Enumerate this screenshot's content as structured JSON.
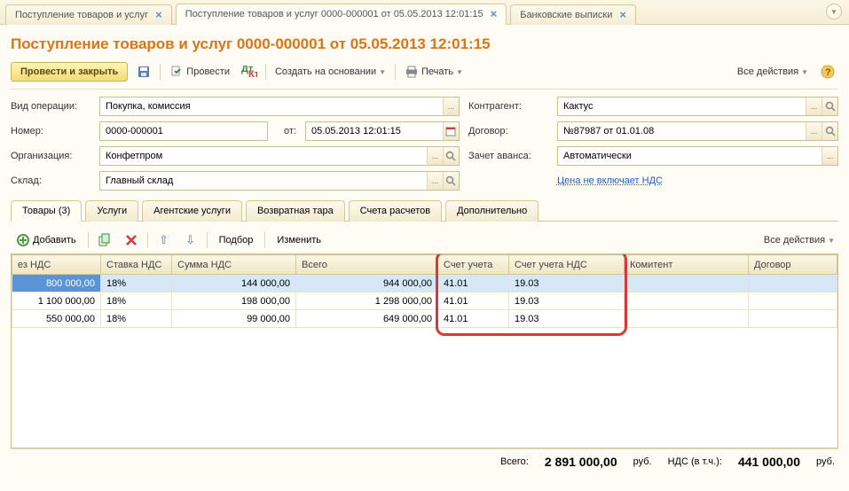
{
  "tabs": [
    {
      "label": "Поступление товаров и услуг"
    },
    {
      "label": "Поступление товаров и услуг 0000-000001 от 05.05.2013 12:01:15"
    },
    {
      "label": "Банковские выписки"
    }
  ],
  "title": "Поступление товаров и услуг 0000-000001 от 05.05.2013 12:01:15",
  "toolbar": {
    "post_close": "Провести и закрыть",
    "post": "Провести",
    "create_based": "Создать на основании",
    "print": "Печать",
    "all_actions": "Все действия"
  },
  "form": {
    "operation_type_label": "Вид операции:",
    "operation_type": "Покупка, комиссия",
    "number_label": "Номер:",
    "number": "0000-000001",
    "date_label": "от:",
    "date": "05.05.2013 12:01:15",
    "organization_label": "Организация:",
    "organization": "Конфетпром",
    "warehouse_label": "Склад:",
    "warehouse": "Главный склад",
    "counterparty_label": "Контрагент:",
    "counterparty": "Кактус",
    "contract_label": "Договор:",
    "contract": "№87987 от 01.01.08",
    "advance_label": "Зачет аванса:",
    "advance": "Автоматически",
    "vat_note": "Цена не включает НДС"
  },
  "subtabs": {
    "goods": "Товары (3)",
    "services": "Услуги",
    "agent": "Агентские услуги",
    "tare": "Возвратная тара",
    "accounts": "Счета расчетов",
    "extra": "Дополнительно"
  },
  "grid_toolbar": {
    "add": "Добавить",
    "pick": "Подбор",
    "edit": "Изменить",
    "all_actions": "Все действия"
  },
  "columns": {
    "no_vat": "ез НДС",
    "vat_rate": "Ставка НДС",
    "vat_sum": "Сумма НДС",
    "total": "Всего",
    "account": "Счет учета",
    "vat_account": "Счет учета НДС",
    "consignor": "Комитент",
    "contract": "Договор"
  },
  "rows": [
    {
      "no_vat": "800 000,00",
      "vat_rate": "18%",
      "vat_sum": "144 000,00",
      "total": "944 000,00",
      "account": "41.01",
      "vat_account": "19.03"
    },
    {
      "no_vat": "1 100 000,00",
      "vat_rate": "18%",
      "vat_sum": "198 000,00",
      "total": "1 298 000,00",
      "account": "41.01",
      "vat_account": "19.03"
    },
    {
      "no_vat": "550 000,00",
      "vat_rate": "18%",
      "vat_sum": "99 000,00",
      "total": "649 000,00",
      "account": "41.01",
      "vat_account": "19.03"
    }
  ],
  "footer": {
    "total_label": "Всего:",
    "total": "2 891 000,00",
    "currency": "руб.",
    "vat_label": "НДС (в т.ч.):",
    "vat": "441 000,00"
  }
}
